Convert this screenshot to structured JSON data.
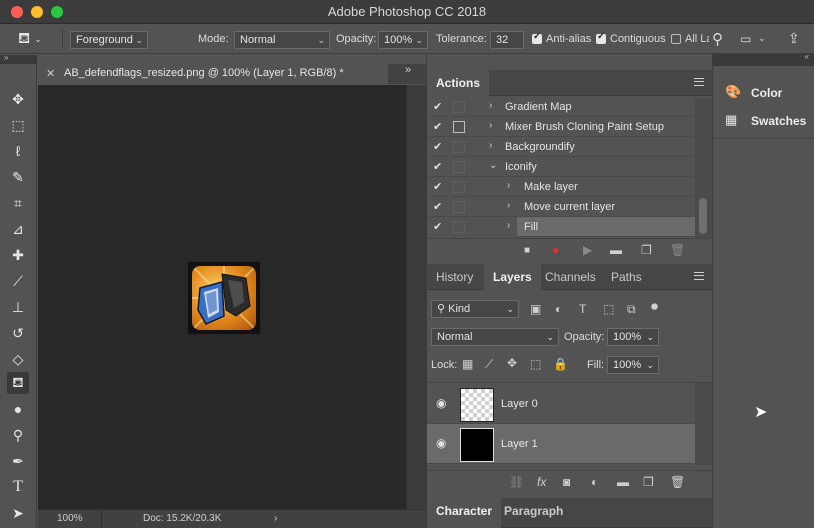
{
  "app_title": "Adobe Photoshop CC 2018",
  "options": {
    "fill_source": "Foreground",
    "mode_label": "Mode:",
    "mode_value": "Normal",
    "opacity_label": "Opacity:",
    "opacity_value": "100%",
    "tolerance_label": "Tolerance:",
    "tolerance_value": "32",
    "antialias_label": "Anti-alias",
    "contiguous_label": "Contiguous",
    "all_layers_label": "All La"
  },
  "document": {
    "tab_title": "AB_defendflags_resized.png @ 100% (Layer 1, RGB/8) *",
    "zoom": "100%",
    "doc_info": "Doc: 15.2K/20.3K"
  },
  "actions_panel": {
    "title": "Actions",
    "items": [
      {
        "label": "Gradient Map",
        "level": 0,
        "expanded": false
      },
      {
        "label": "Mixer Brush Cloning Paint Setup",
        "level": 0,
        "expanded": false
      },
      {
        "label": "Backgroundify",
        "level": 0,
        "expanded": false
      },
      {
        "label": "Iconify",
        "level": 0,
        "expanded": true
      },
      {
        "label": "Make layer",
        "level": 1,
        "expanded": false
      },
      {
        "label": "Move current layer",
        "level": 1,
        "expanded": false
      },
      {
        "label": "Fill",
        "level": 1,
        "expanded": false
      }
    ]
  },
  "layers_panel": {
    "tabs": [
      "History",
      "Layers",
      "Channels",
      "Paths"
    ],
    "active_tab": "Layers",
    "filter_kind": "Kind",
    "blend_mode": "Normal",
    "opacity_label": "Opacity:",
    "opacity_value": "100%",
    "lock_label": "Lock:",
    "fill_label": "Fill:",
    "fill_value": "100%",
    "layers": [
      {
        "name": "Layer 0",
        "thumb": "checker"
      },
      {
        "name": "Layer 1",
        "thumb": "black"
      }
    ]
  },
  "bottom_panel": {
    "tabs": [
      "Character",
      "Paragraph"
    ],
    "active_tab": "Character"
  },
  "side_panel": {
    "items": [
      {
        "label": "Color",
        "icon": "palette-icon"
      },
      {
        "label": "Swatches",
        "icon": "grid-icon"
      }
    ]
  }
}
